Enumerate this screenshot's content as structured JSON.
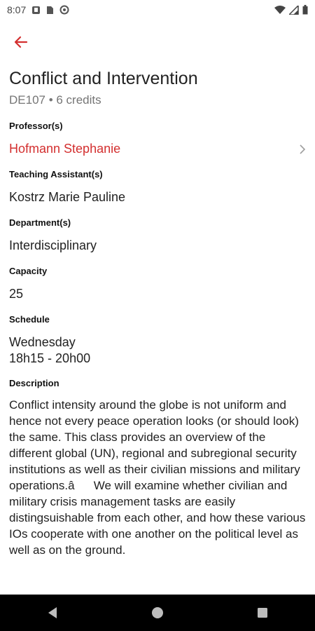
{
  "status_bar": {
    "time": "8:07",
    "left_icons": [
      "notification-icon",
      "sim-icon",
      "sync-icon"
    ],
    "right_icons": [
      "wifi-icon",
      "signal-icon",
      "battery-icon"
    ]
  },
  "colors": {
    "accent": "#d32f2f",
    "text": "#222222",
    "muted": "#757575",
    "navbar": "#000000"
  },
  "course": {
    "title": "Conflict and Intervention",
    "subtitle": "DE107 • 6 credits"
  },
  "sections": {
    "professor_label": "Professor(s)",
    "professor_name": "Hofmann Stephanie",
    "ta_label": "Teaching Assistant(s)",
    "ta_name": "Kostrz Marie Pauline",
    "department_label": "Department(s)",
    "department_value": "Interdisciplinary",
    "capacity_label": "Capacity",
    "capacity_value": "25",
    "schedule_label": "Schedule",
    "schedule_day": "Wednesday",
    "schedule_time": "18h15 - 20h00",
    "description_label": "Description",
    "description_text": "Conflict intensity around the globe is not uniform and hence not every peace operation looks (or should look) the same. This class provides an overview of the different global (UN), regional and subregional security institutions as well as their civilian missions and military operations.âWe will examine whether civilian and military crisis management tasks are easily distingsuishable from each other, and how these various IOs cooperate with one another on the political level as well as on the ground."
  },
  "navigation": {
    "buttons": [
      "back-nav-icon",
      "home-nav-icon",
      "recents-nav-icon"
    ]
  }
}
